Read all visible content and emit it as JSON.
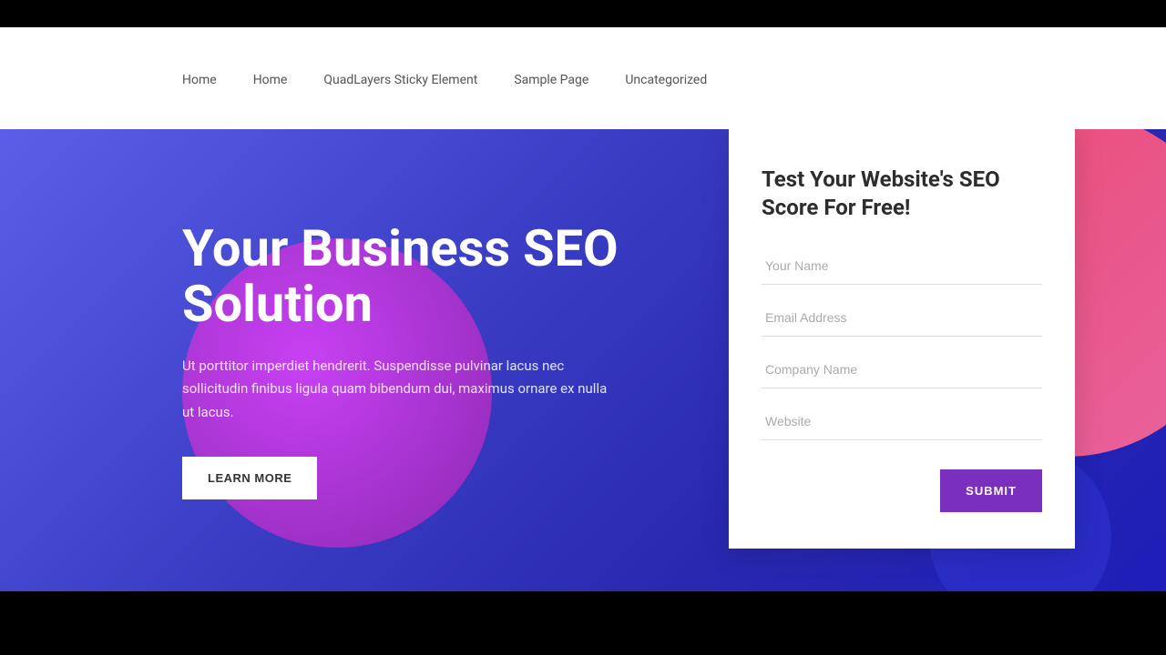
{
  "topbar": {},
  "nav": {
    "items": [
      {
        "label": "Home",
        "id": "nav-home-1"
      },
      {
        "label": "Home",
        "id": "nav-home-2"
      },
      {
        "label": "QuadLayers Sticky Element",
        "id": "nav-quadlayers"
      },
      {
        "label": "Sample Page",
        "id": "nav-sample"
      },
      {
        "label": "Uncategorized",
        "id": "nav-uncategorized"
      }
    ]
  },
  "hero": {
    "title": "Your Business SEO Solution",
    "description": "Ut porttitor imperdiet hendrerit. Suspendisse pulvinar lacus nec sollicitudin finibus ligula quam bibendum dui, maximus ornare ex nulla ut lacus.",
    "learn_more_label": "LEARN MORE"
  },
  "form": {
    "title": "Test Your Website's SEO Score For Free!",
    "fields": [
      {
        "placeholder": "Your Name",
        "id": "name-field",
        "type": "text"
      },
      {
        "placeholder": "Email Address",
        "id": "email-field",
        "type": "email"
      },
      {
        "placeholder": "Company Name",
        "id": "company-field",
        "type": "text"
      },
      {
        "placeholder": "Website",
        "id": "website-field",
        "type": "text"
      }
    ],
    "submit_label": "SUBMIT"
  }
}
